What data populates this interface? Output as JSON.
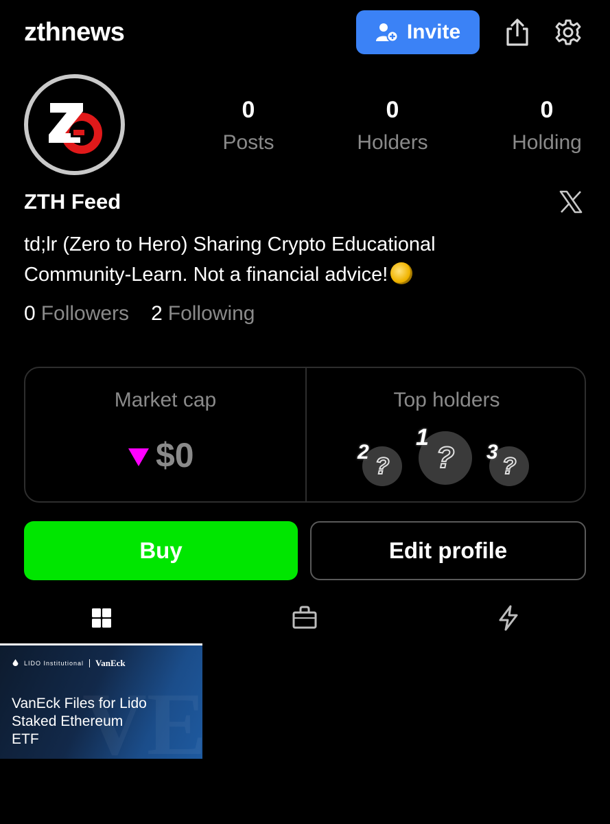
{
  "header": {
    "app_title": "zthnews",
    "invite_label": "Invite"
  },
  "stats": [
    {
      "value": "0",
      "label": "Posts"
    },
    {
      "value": "0",
      "label": "Holders"
    },
    {
      "value": "0",
      "label": "Holding"
    }
  ],
  "profile": {
    "display_name": "ZTH Feed",
    "bio_line1": "td;lr (Zero to Hero) Sharing Crypto Educational",
    "bio_line2": "Community-Learn. Not a financial advice!",
    "followers_count": "0",
    "followers_label": "Followers",
    "following_count": "2",
    "following_label": "Following"
  },
  "market": {
    "title": "Market cap",
    "value": "$0",
    "trend": "down",
    "trend_color": "#ff00ff"
  },
  "top_holders": {
    "title": "Top holders",
    "slots": [
      {
        "rank": "2",
        "placeholder": "?"
      },
      {
        "rank": "1",
        "placeholder": "?"
      },
      {
        "rank": "3",
        "placeholder": "?"
      }
    ]
  },
  "actions": {
    "buy_label": "Buy",
    "buy_color": "#00e600",
    "edit_label": "Edit profile"
  },
  "tabs": [
    {
      "icon": "grid-icon",
      "active": true
    },
    {
      "icon": "shopping-bag-icon",
      "active": false
    },
    {
      "icon": "lightning-icon",
      "active": false
    }
  ],
  "posts": [
    {
      "logo_left": "LIDO Institutional",
      "logo_right": "VanEck",
      "title": "VanEck Files for Lido Staked Ethereum ETF"
    }
  ],
  "colors": {
    "accent_blue": "#3b82f6",
    "muted_text": "#8a8a8a"
  }
}
